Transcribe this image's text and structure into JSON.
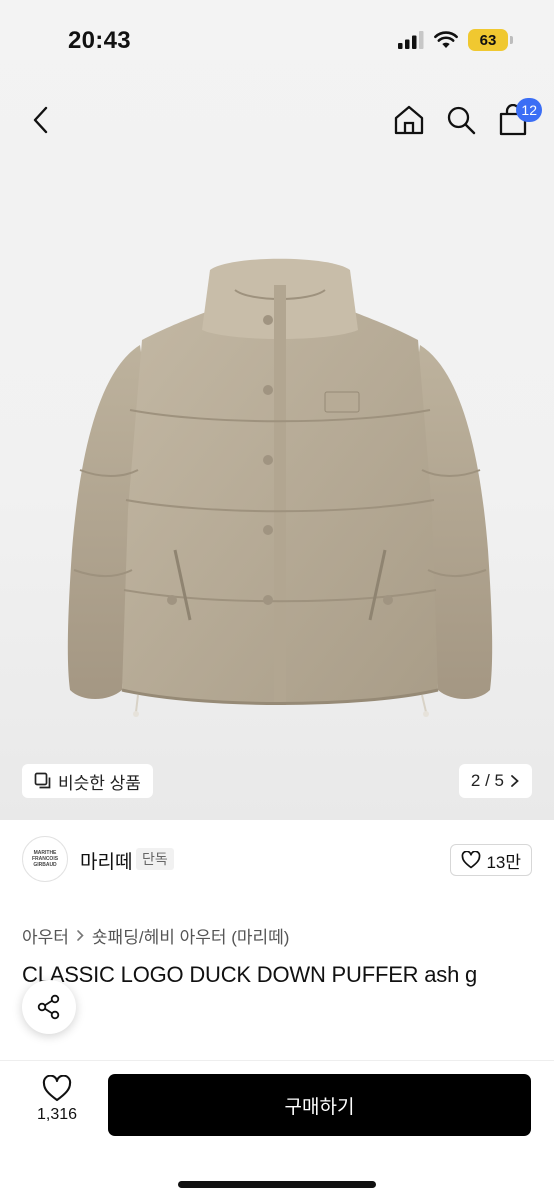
{
  "status_bar": {
    "time": "20:43",
    "battery": "63"
  },
  "nav": {
    "cart_count": "12"
  },
  "gallery": {
    "similar_label": "비슷한 상품",
    "pager": "2 / 5"
  },
  "brand": {
    "logo_text_line1": "MARITHE",
    "logo_text_line2": "FRANCOIS",
    "logo_text_line3": "GIRBAUD",
    "name": "마리떼",
    "tag": "단독",
    "likes": "13만"
  },
  "breadcrumb": {
    "category": "아우터",
    "subcategory": "숏패딩/헤비 아우터 (마리떼)"
  },
  "product": {
    "title": "CLASSIC LOGO DUCK DOWN PUFFER ash g"
  },
  "bottom": {
    "wish_count": "1,316",
    "buy_label": "구매하기"
  },
  "icons": [
    "back-icon",
    "home-icon",
    "search-icon",
    "cart-icon",
    "similar-icon",
    "chevron-right-icon",
    "heart-icon",
    "share-icon",
    "signal-icon",
    "wifi-icon"
  ]
}
